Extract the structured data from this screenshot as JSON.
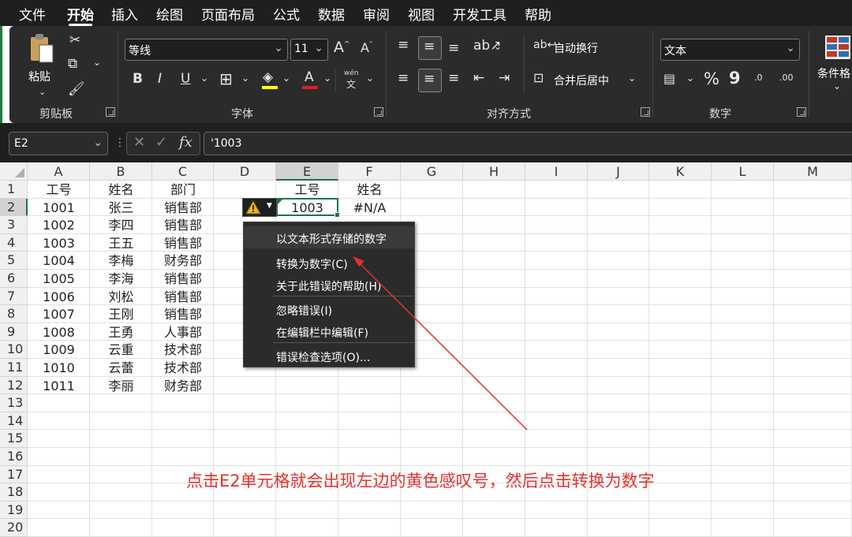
{
  "menubar": {
    "tabs": [
      "文件",
      "开始",
      "插入",
      "绘图",
      "页面布局",
      "公式",
      "数据",
      "审阅",
      "视图",
      "开发工具",
      "帮助"
    ],
    "active": "开始"
  },
  "ribbon": {
    "clipboard": {
      "paste_label": "粘贴",
      "group_label": "剪贴板"
    },
    "font": {
      "font_name": "等线",
      "font_size": "11",
      "group_label": "字体",
      "phonetic_top": "wén",
      "phonetic_bottom": "文"
    },
    "alignment": {
      "wrap_label": "自动换行",
      "merge_label": "合并后居中",
      "group_label": "对齐方式"
    },
    "number": {
      "format_value": "文本",
      "group_label": "数字",
      "percent": "%",
      "comma": "9",
      "dec_inc": ".0",
      "dec_dec": ".00"
    },
    "styles": {
      "cond_format_label": "条件格"
    }
  },
  "formula_bar": {
    "name_box": "E2",
    "content": "'1003",
    "fx_label": "fx"
  },
  "sheet": {
    "columns": [
      "A",
      "B",
      "C",
      "D",
      "E",
      "F",
      "G",
      "H",
      "I",
      "J",
      "K",
      "L",
      "M"
    ],
    "rows": [
      "1",
      "2",
      "3",
      "4",
      "5",
      "6",
      "7",
      "8",
      "9",
      "10",
      "11",
      "12",
      "13",
      "14",
      "15",
      "16",
      "17",
      "18",
      "19",
      "20"
    ],
    "table_header": {
      "a": "工号",
      "b": "姓名",
      "c": "部门"
    },
    "table_rows": [
      {
        "a": "1001",
        "b": "张三",
        "c": "销售部"
      },
      {
        "a": "1002",
        "b": "李四",
        "c": "销售部"
      },
      {
        "a": "1003",
        "b": "王五",
        "c": "销售部"
      },
      {
        "a": "1004",
        "b": "李梅",
        "c": "财务部"
      },
      {
        "a": "1005",
        "b": "李海",
        "c": "销售部"
      },
      {
        "a": "1006",
        "b": "刘松",
        "c": "销售部"
      },
      {
        "a": "1007",
        "b": "王刚",
        "c": "销售部"
      },
      {
        "a": "1008",
        "b": "王勇",
        "c": "人事部"
      },
      {
        "a": "1009",
        "b": "云重",
        "c": "技术部"
      },
      {
        "a": "1010",
        "b": "云蕾",
        "c": "技术部"
      },
      {
        "a": "1011",
        "b": "李丽",
        "c": "财务部"
      }
    ],
    "lookup_header": {
      "e": "工号",
      "f": "姓名"
    },
    "lookup_row": {
      "e": "1003",
      "f": "#N/A"
    }
  },
  "error_menu": {
    "header": "以文本形式存储的数字",
    "items": [
      "转换为数字(C)",
      "关于此错误的帮助(H)",
      "忽略错误(I)",
      "在编辑栏中编辑(F)",
      "错误检查选项(O)..."
    ]
  },
  "annotation": {
    "text": "点击E2单元格就会出现左边的黄色感叹号，然后点击转换为数字",
    "color": "#e5312e"
  },
  "colors": {
    "accent": "#217346",
    "warning": "#f0b323"
  }
}
